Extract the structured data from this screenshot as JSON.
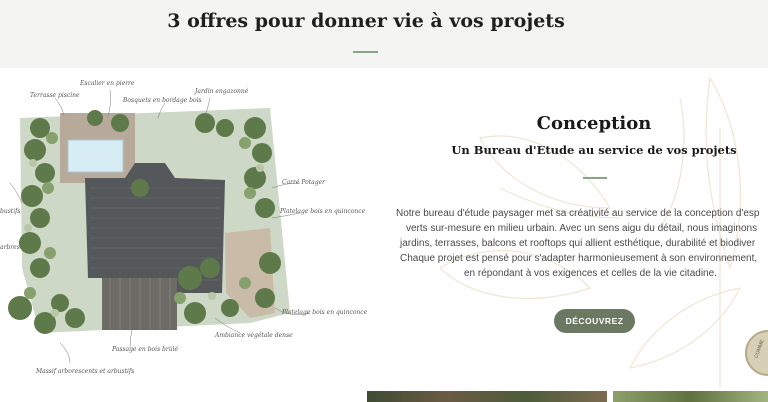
{
  "header": {
    "title": "3 offres pour donner vie à vos projets"
  },
  "plan": {
    "labels": [
      "Terrasse piscine",
      "Escalier en pierre",
      "Bosquets en bordage bois",
      "Jardin engazonné",
      "Carré Potager",
      "Platelage bois en quinconce",
      "Platelage bois en quinconce",
      "Ambiance végétale dense",
      "Passage en bois brûlé",
      "Massif arborescents et arbustifs",
      "bustifs",
      "arbres"
    ]
  },
  "card": {
    "title": "Conception",
    "subtitle": "Un Bureau d'Etude au service de vos projets",
    "body": [
      "Notre bureau d'étude paysager met sa créativité au service de la conception d'esp",
      "verts sur-mesure en milieu urbain. Avec un sens aigu du détail, nous imaginons",
      "jardins, terrasses, balcons et rooftops qui allient esthétique, durabilité et biodiver",
      "Chaque projet est pensé pour s'adapter harmonieusement à son environnement,",
      "en répondant à vos exigences et celles de la vie citadine."
    ],
    "button_label": "DÉCOUVREZ"
  },
  "seal": {
    "text": "COMME"
  },
  "colors": {
    "accent_green": "#8aa585",
    "button_bg": "#6b7963",
    "header_band": "#f4f4f2"
  }
}
